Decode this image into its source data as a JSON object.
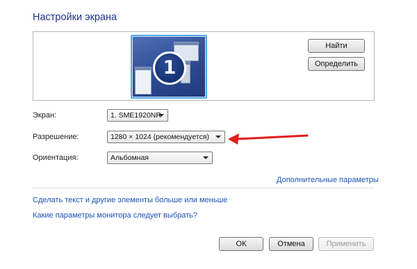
{
  "page": {
    "title": "Настройки экрана"
  },
  "preview": {
    "monitor_number": "1"
  },
  "buttons": {
    "find": "Найти",
    "identify": "Определить",
    "ok": "ОК",
    "cancel": "Отмена",
    "apply": "Применить"
  },
  "fields": {
    "display": {
      "label": "Экран:",
      "value": "1. SME1920NR"
    },
    "resolution": {
      "label": "Разрешение:",
      "value": "1280 × 1024 (рекомендуется)"
    },
    "orientation": {
      "label": "Ориентация:",
      "value": "Альбомная"
    }
  },
  "links": {
    "advanced": "Дополнительные параметры",
    "text_size": "Сделать текст и другие элементы больше или меньше",
    "which_settings": "Какие параметры монитора следует выбрать?"
  },
  "colors": {
    "accent_arrow": "#e01b1b",
    "title": "#1e3287",
    "link": "#1a52b4"
  }
}
